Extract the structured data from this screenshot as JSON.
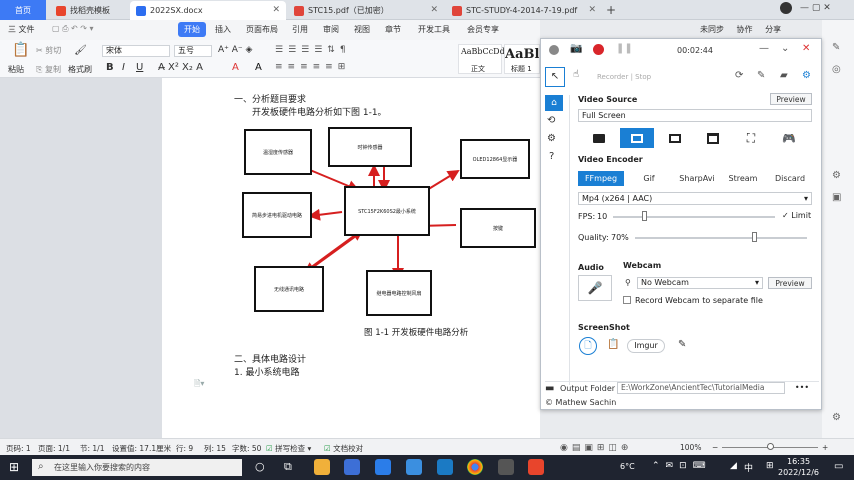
{
  "tabs": [
    {
      "label": "首页"
    },
    {
      "label": "找稻壳模板"
    },
    {
      "label": "2022SX.docx"
    },
    {
      "label": "STC15.pdf（已加密）"
    },
    {
      "label": "STC-STUDY-4-2014-7-19.pdf"
    }
  ],
  "top_right": {
    "sync": "未同步",
    "coop": "协作",
    "share": "分享"
  },
  "menu": {
    "file": "三 文件",
    "items": [
      "开始",
      "插入",
      "页面布局",
      "引用",
      "审阅",
      "视图",
      "章节",
      "开发工具",
      "会员专享"
    ],
    "search": "Q 查找命令、搜索模板"
  },
  "ribbon": {
    "paste": "粘贴",
    "cut": "剪切",
    "copy": "复制",
    "format_painter": "格式刷",
    "font": "宋体",
    "size": "五号",
    "style_sample_1": "AaBbCcDd",
    "style_sample_2": "AaBl",
    "style_1": "正文",
    "style_2": "标题 1"
  },
  "document": {
    "heading1": "一、分析题目要求",
    "para1": "开发板硬件电路分析如下图 1-1。",
    "boxes": {
      "temp": "温湿度传感器",
      "clock": "时钟传感器",
      "oled": "OLED12864显示器",
      "motor": "简易步进电机驱动电路",
      "mcu": "STC15F2K60S2最小系统",
      "key": "按键",
      "wireless": "无线通讯电路",
      "fan": "继电器电路控制风扇"
    },
    "caption": "图 1-1  开发板硬件电路分析",
    "heading2": "二、具体电路设计",
    "heading3": "1.  最小系统电路"
  },
  "recorder": {
    "timer": "00:02:44",
    "recorder_stop": "Recorder | Stop",
    "video_source_label": "Video Source",
    "preview": "Preview",
    "source_value": "Full Screen",
    "video_encoder_label": "Video Encoder",
    "encoders": [
      "FFmpeg",
      "Gif",
      "SharpAvi",
      "Stream",
      "Discard"
    ],
    "format": "Mp4 (x264 | AAC)",
    "fps_label": "FPS:",
    "fps_value": "10",
    "fps_fraction": 0.2,
    "limit": "Limit",
    "quality_label": "Quality:",
    "quality_value": "70%",
    "quality_fraction": 0.7,
    "audio_label": "Audio",
    "webcam_label": "Webcam",
    "webcam_value": "No Webcam",
    "webcam_preview": "Preview",
    "record_webcam": "Record Webcam to separate file",
    "screenshot_label": "ScreenShot",
    "imgur": "Imgur",
    "output_folder_label": "Output Folder",
    "output_folder": "E:\\WorkZone\\AncientTec\\TutorialMedia",
    "more": "•••",
    "copyright": "© Mathew Sachin",
    "accent": "#1a7fd4"
  },
  "status": {
    "page": "页码: 1",
    "pages": "页面: 1/1",
    "section": "节: 1/1",
    "setting": "设置值: 17.1厘米",
    "row": "行: 9",
    "col": "列: 15",
    "words": "字数: 50",
    "spell": "拼写检查 ▾",
    "proof": "文档校对",
    "zoom": "100%",
    "zoom_fraction": 0.5
  },
  "taskbar": {
    "search_placeholder": "在这里输入你要搜索的内容",
    "temp": "6°C",
    "ime": "中",
    "time": "16:35",
    "date": "2022/12/6"
  }
}
